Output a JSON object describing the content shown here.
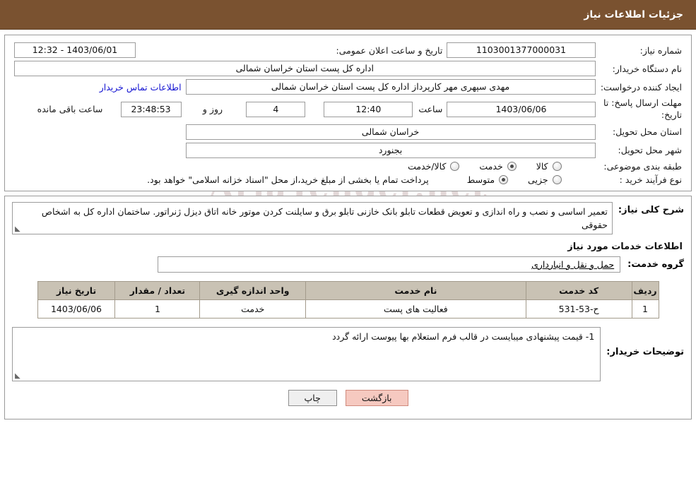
{
  "header": {
    "title": "جزئیات اطلاعات نیاز"
  },
  "watermark": {
    "text": "AriaTender.net"
  },
  "form": {
    "need_number_label": "شماره نیاز:",
    "need_number_value": "1103001377000031",
    "public_announce_label": "تاریخ و ساعت اعلان عمومی:",
    "public_announce_value": "1403/06/01 - 12:32",
    "buyer_org_label": "نام دستگاه خریدار:",
    "buyer_org_value": "اداره کل پست استان خراسان شمالی",
    "requester_label": "ایجاد کننده درخواست:",
    "requester_value": "مهدی سپهری مهر کارپرداز اداره کل پست استان خراسان شمالی",
    "buyer_contact_link": "اطلاعات تماس خریدار",
    "deadline_label": "مهلت ارسال پاسخ: تا تاریخ:",
    "deadline_date": "1403/06/06",
    "hour_label": "ساعت",
    "deadline_time": "12:40",
    "days_value": "4",
    "days_label": "روز و",
    "countdown_value": "23:48:53",
    "remaining_label": "ساعت باقی مانده",
    "province_label": "استان محل تحویل:",
    "province_value": "خراسان شمالی",
    "city_label": "شهر محل تحویل:",
    "city_value": "بجنورد",
    "category_label": "طبقه بندی موضوعی:",
    "category_options": [
      {
        "label": "کالا",
        "checked": false
      },
      {
        "label": "خدمت",
        "checked": true
      },
      {
        "label": "کالا/خدمت",
        "checked": false
      }
    ],
    "purchase_type_label": "نوع فرآیند خرید :",
    "purchase_type_options": [
      {
        "label": "جزیی",
        "checked": false
      },
      {
        "label": "متوسط",
        "checked": true
      }
    ],
    "payment_note": "پرداخت تمام یا بخشی از مبلغ خرید،از محل \"اسناد خزانه اسلامی\" خواهد بود."
  },
  "description": {
    "label": "شرح کلی نیاز:",
    "text": "تعمیر اساسی و نصب و راه اندازی و تعویض قطعات  تابلو بانک خازنی تابلو برق  و سایلنت کردن موتور خانه اتاق دیزل ژنراتور. ساختمان اداره کل  به اشخاص حقوقی"
  },
  "services": {
    "section_title": "اطلاعات خدمات مورد نیاز",
    "group_label": "گروه خدمت:",
    "group_value": "حمل و نقل و انبارداری",
    "table": {
      "headers": [
        "ردیف",
        "کد خدمت",
        "نام خدمت",
        "واحد اندازه گیری",
        "تعداد / مقدار",
        "تاریخ نیاز"
      ],
      "rows": [
        {
          "row": "1",
          "code": "ح-53-531",
          "name": "فعالیت های پست",
          "unit": "خدمت",
          "qty": "1",
          "date": "1403/06/06"
        }
      ]
    }
  },
  "buyer_notes": {
    "label": "توضیحات خریدار:",
    "text": "1- قیمت پیشنهادی میبایست در قالب فرم استعلام بها پیوست ارائه گردد"
  },
  "buttons": {
    "print": "چاپ",
    "back": "بازگشت"
  }
}
